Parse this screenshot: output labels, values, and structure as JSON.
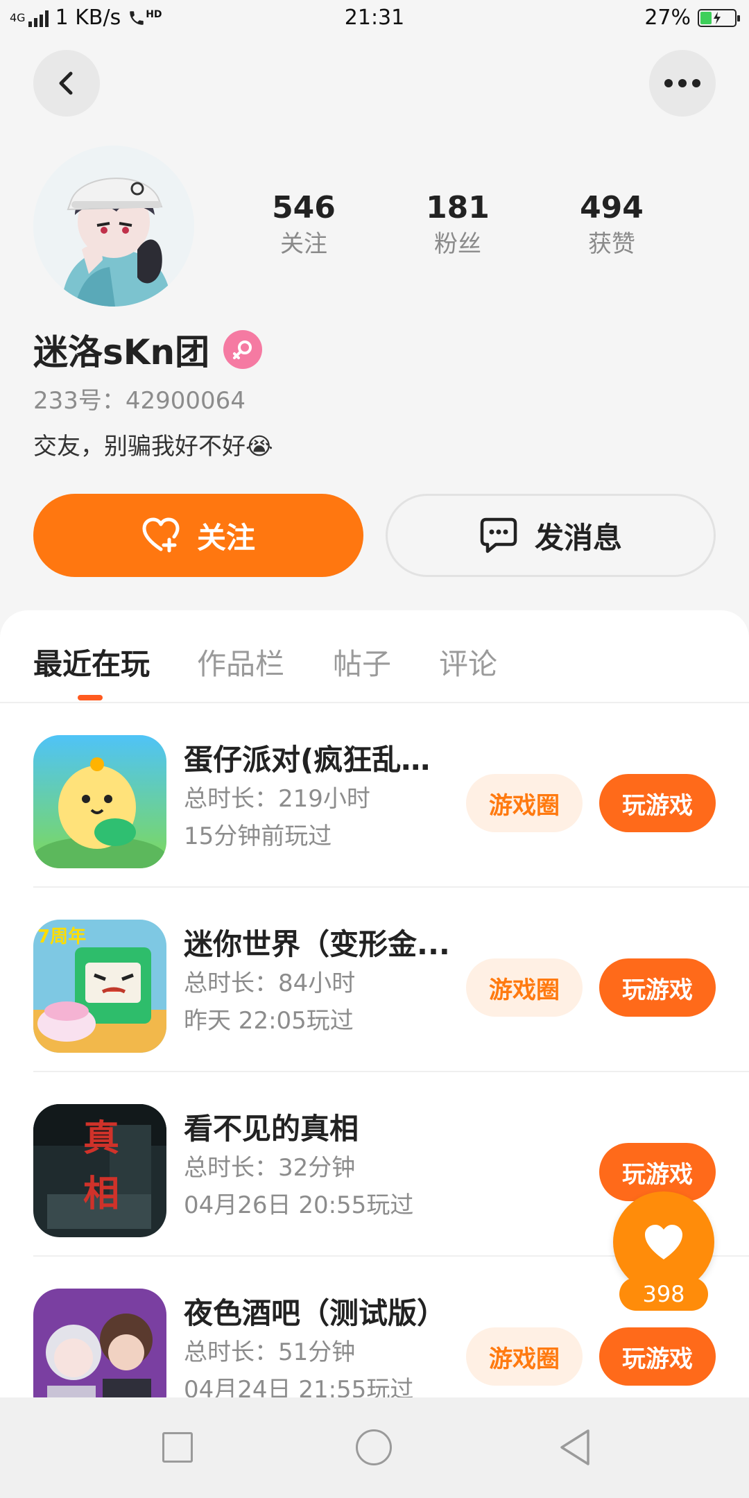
{
  "status_bar": {
    "network": "4G",
    "speed": "1 KB/s",
    "hd": "HD",
    "time": "21:31",
    "battery": "27%"
  },
  "profile": {
    "stats": [
      {
        "num": "546",
        "label": "关注"
      },
      {
        "num": "181",
        "label": "粉丝"
      },
      {
        "num": "494",
        "label": "获赞"
      }
    ],
    "name": "迷洛sKn团",
    "uid": "233号：42900064",
    "bio": "交友，别骗我好不好😭"
  },
  "actions": {
    "follow": "关注",
    "message": "发消息"
  },
  "tabs": [
    "最近在玩",
    "作品栏",
    "帖子",
    "评论"
  ],
  "games": [
    {
      "title": "蛋仔派对(疯狂乱斗...",
      "duration": "总时长：219小时",
      "last": "15分钟前玩过",
      "circle": "游戏圈",
      "play": "玩游戏"
    },
    {
      "title": "迷你世界（变形金...",
      "duration": "总时长：84小时",
      "last": "昨天 22:05玩过",
      "circle": "游戏圈",
      "play": "玩游戏"
    },
    {
      "title": "看不见的真相",
      "duration": "总时长：32分钟",
      "last": "04月26日 20:55玩过",
      "circle": "",
      "play": "玩游戏"
    },
    {
      "title": "夜色酒吧（测试版）",
      "duration": "总时长：51分钟",
      "last": "04月24日 21:55玩过",
      "circle": "游戏圈",
      "play": "玩游戏"
    }
  ],
  "icon_texts": {
    "anniversary": "7周年",
    "truth": "真相"
  },
  "float_like": {
    "count": "398"
  },
  "colors": {
    "accent": "#ff7710",
    "accent_light": "#fff0e4",
    "gender": "#f57aa2"
  }
}
